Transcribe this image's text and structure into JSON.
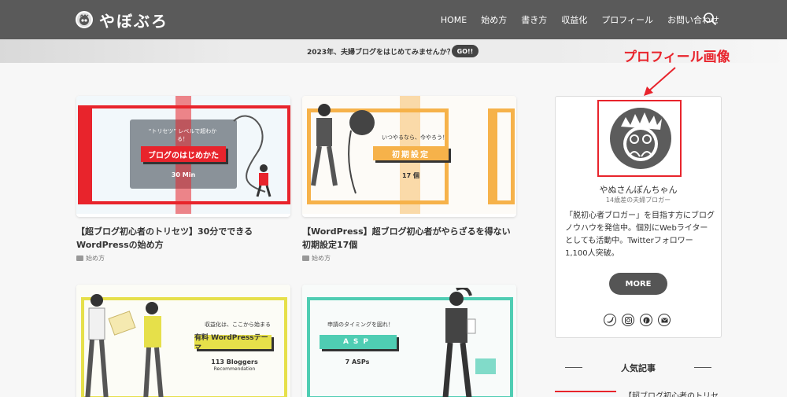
{
  "header": {
    "logo_text": "やぼぶろ",
    "nav": [
      "HOME",
      "始め方",
      "書き方",
      "収益化",
      "プロフィール",
      "お問い合わせ"
    ],
    "search_icon": "search-icon"
  },
  "banner": {
    "text": "2023年、夫婦ブログをはじめてみませんか？",
    "button": "GO!!"
  },
  "annotation": {
    "label": "プロフィール画像",
    "color": "#e8242c"
  },
  "articles": [
    {
      "thumb_top": "“トリセツ” レベルで超わかる！",
      "thumb_ribbon": "ブログのはじめかた",
      "thumb_sub": "30 Min",
      "title_line1": "【超ブログ初心者のトリセツ】30分でできる",
      "title_line2": "WordPressの始め方",
      "category": "始め方",
      "accent": "#e8242c"
    },
    {
      "thumb_top": "いつやるなら、今やろう！",
      "thumb_ribbon": "初期設定",
      "thumb_sub": "17 個",
      "title_line1": "【WordPress】超ブログ初心者がやらざるを得ない",
      "title_line2": "初期設定17個",
      "category": "始め方",
      "accent": "#f6b24a"
    },
    {
      "thumb_top": "収益化は、ここから始まる",
      "thumb_ribbon": "有料 WordPressテーマ",
      "thumb_sub": "113 Bloggers",
      "thumb_sub2": "Recommendation",
      "accent": "#e6e04a"
    },
    {
      "thumb_top": "申請のタイミングを図れ！",
      "thumb_ribbon": "ASP",
      "thumb_sub": "7 ASPs",
      "accent": "#4fcdb3"
    }
  ],
  "profile": {
    "name": "やぬさんぽんちゃん",
    "subtitle": "14歳差の夫婦ブロガー",
    "description": "「脱初心者ブロガー」を目指す方にブログノウハウを発信中。個別にWebライターとしても活動中。Twitterフォロワー1,100人突破。",
    "more_button": "MORE",
    "sns": [
      "twitter-icon",
      "instagram-icon",
      "pinterest-icon",
      "mail-icon"
    ]
  },
  "popular": {
    "title": "人気記事",
    "first_item": "【超ブログ初心者のトリセ"
  }
}
